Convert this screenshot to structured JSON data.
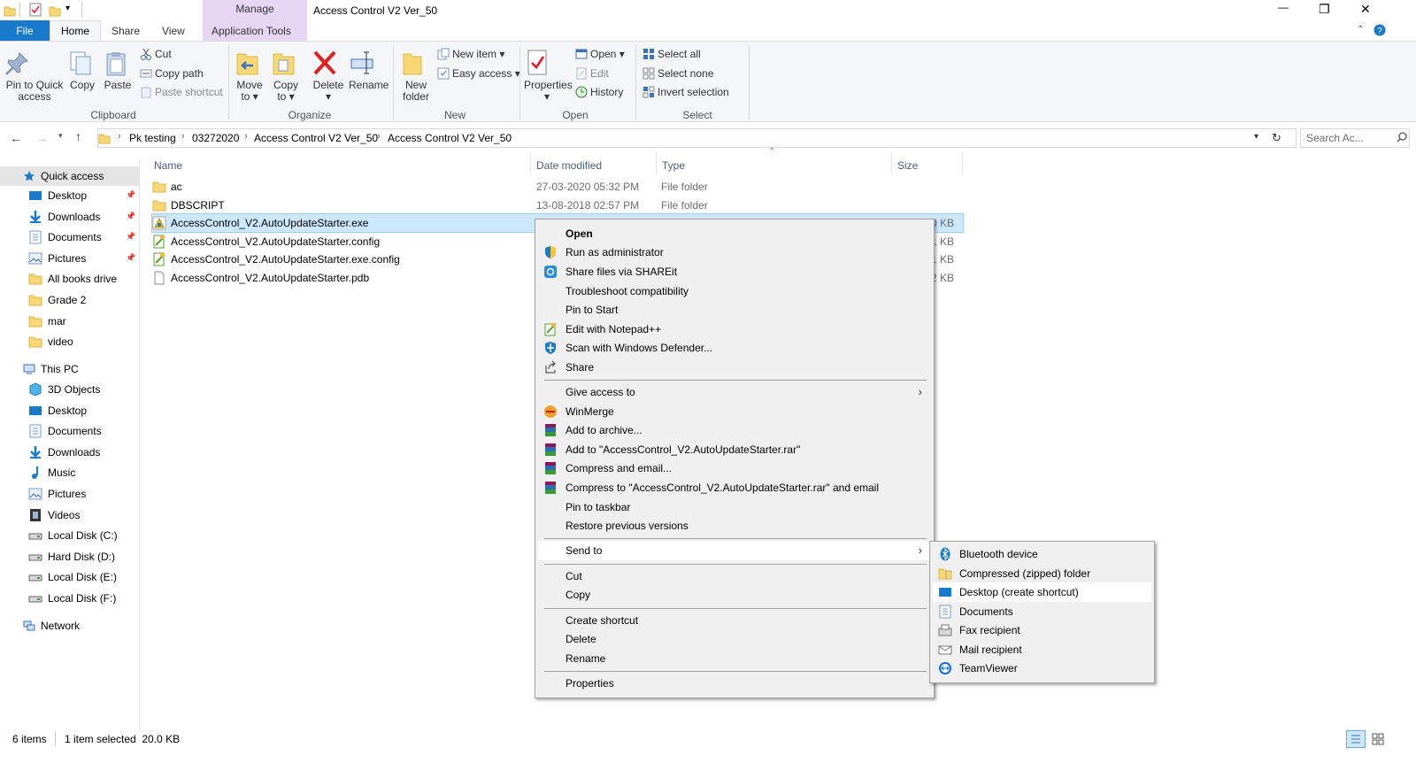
{
  "window": {
    "title": "Access Control V2 Ver_50",
    "contextual_tab_group": "Manage",
    "min_glyph": "—",
    "restore_glyph": "❐",
    "close_glyph": "✕"
  },
  "tabs": {
    "file": "File",
    "home": "Home",
    "share": "Share",
    "view": "View",
    "app_tools": "Application Tools"
  },
  "ribbon": {
    "clipboard": {
      "pin_label_1": "Pin to Quick",
      "pin_label_2": "access",
      "copy": "Copy",
      "paste": "Paste",
      "cut": "Cut",
      "copy_path": "Copy path",
      "paste_shortcut": "Paste shortcut",
      "group": "Clipboard"
    },
    "organize": {
      "move_1": "Move",
      "move_2": "to ▾",
      "copy_1": "Copy",
      "copy_2": "to ▾",
      "delete_1": "Delete",
      "delete_2": "▾",
      "rename": "Rename",
      "group": "Organize"
    },
    "new": {
      "folder_1": "New",
      "folder_2": "folder",
      "new_item": "New item ▾",
      "easy_access": "Easy access ▾",
      "group": "New"
    },
    "open": {
      "properties_1": "Properties",
      "properties_2": "▾",
      "open": "Open ▾",
      "edit": "Edit",
      "history": "History",
      "group": "Open"
    },
    "select": {
      "select_all": "Select all",
      "select_none": "Select none",
      "invert": "Invert selection",
      "group": "Select"
    }
  },
  "address": {
    "crumbs": [
      "Pk testing",
      "03272020",
      "Access Control V2 Ver_50",
      "Access Control V2 Ver_50"
    ],
    "search_placeholder": "Search Ac..."
  },
  "nav": {
    "quick_access": "Quick access",
    "quick_items": [
      "Desktop",
      "Downloads",
      "Documents",
      "Pictures",
      "All books drive",
      "Grade 2",
      "mar",
      "video"
    ],
    "this_pc": "This PC",
    "pc_items": [
      "3D Objects",
      "Desktop",
      "Documents",
      "Downloads",
      "Music",
      "Pictures",
      "Videos",
      "Local Disk (C:)",
      "Hard Disk (D:)",
      "Local Disk (E:)",
      "Local Disk (F:)"
    ],
    "network": "Network"
  },
  "columns": {
    "name": "Name",
    "date": "Date modified",
    "type": "Type",
    "size": "Size"
  },
  "files": [
    {
      "name": "ac",
      "date": "27-03-2020 05:32 PM",
      "type": "File folder",
      "size": ""
    },
    {
      "name": "DBSCRIPT",
      "date": "13-08-2018 02:57 PM",
      "type": "File folder",
      "size": ""
    },
    {
      "name": "AccessControl_V2.AutoUpdateStarter.exe",
      "date": "",
      "type": "",
      "size": "0 KB"
    },
    {
      "name": "AccessControl_V2.AutoUpdateStarter.config",
      "date": "",
      "type": "",
      "size": "1 KB"
    },
    {
      "name": "AccessControl_V2.AutoUpdateStarter.exe.config",
      "date": "",
      "type": "",
      "size": "1 KB"
    },
    {
      "name": "AccessControl_V2.AutoUpdateStarter.pdb",
      "date": "",
      "type": "",
      "size": "2 KB"
    }
  ],
  "context_menu": {
    "open": "Open",
    "run_admin": "Run as administrator",
    "shareit": "Share files via SHAREit",
    "troubleshoot": "Troubleshoot compatibility",
    "pin_start": "Pin to Start",
    "notepad": "Edit with Notepad++",
    "defender": "Scan with Windows Defender...",
    "share": "Share",
    "give_access": "Give access to",
    "winmerge": "WinMerge",
    "add_archive": "Add to archive...",
    "add_rar": "Add to \"AccessControl_V2.AutoUpdateStarter.rar\"",
    "compress_email": "Compress and email...",
    "compress_rar_email": "Compress to \"AccessControl_V2.AutoUpdateStarter.rar\" and email",
    "pin_taskbar": "Pin to taskbar",
    "restore": "Restore previous versions",
    "send_to": "Send to",
    "cut": "Cut",
    "copy": "Copy",
    "create_shortcut": "Create shortcut",
    "delete": "Delete",
    "rename": "Rename",
    "properties": "Properties"
  },
  "send_to_menu": [
    "Bluetooth device",
    "Compressed (zipped) folder",
    "Desktop (create shortcut)",
    "Documents",
    "Fax recipient",
    "Mail recipient",
    "TeamViewer"
  ],
  "status": {
    "items": "6 items",
    "selected": "1 item selected  20.0 KB"
  },
  "colors": {
    "accent": "#1979ca",
    "selection": "#cce8ff",
    "menu_bg": "#f0f0f0",
    "contextual_tab": "#e7d6f3",
    "folder": "#f8d775"
  }
}
